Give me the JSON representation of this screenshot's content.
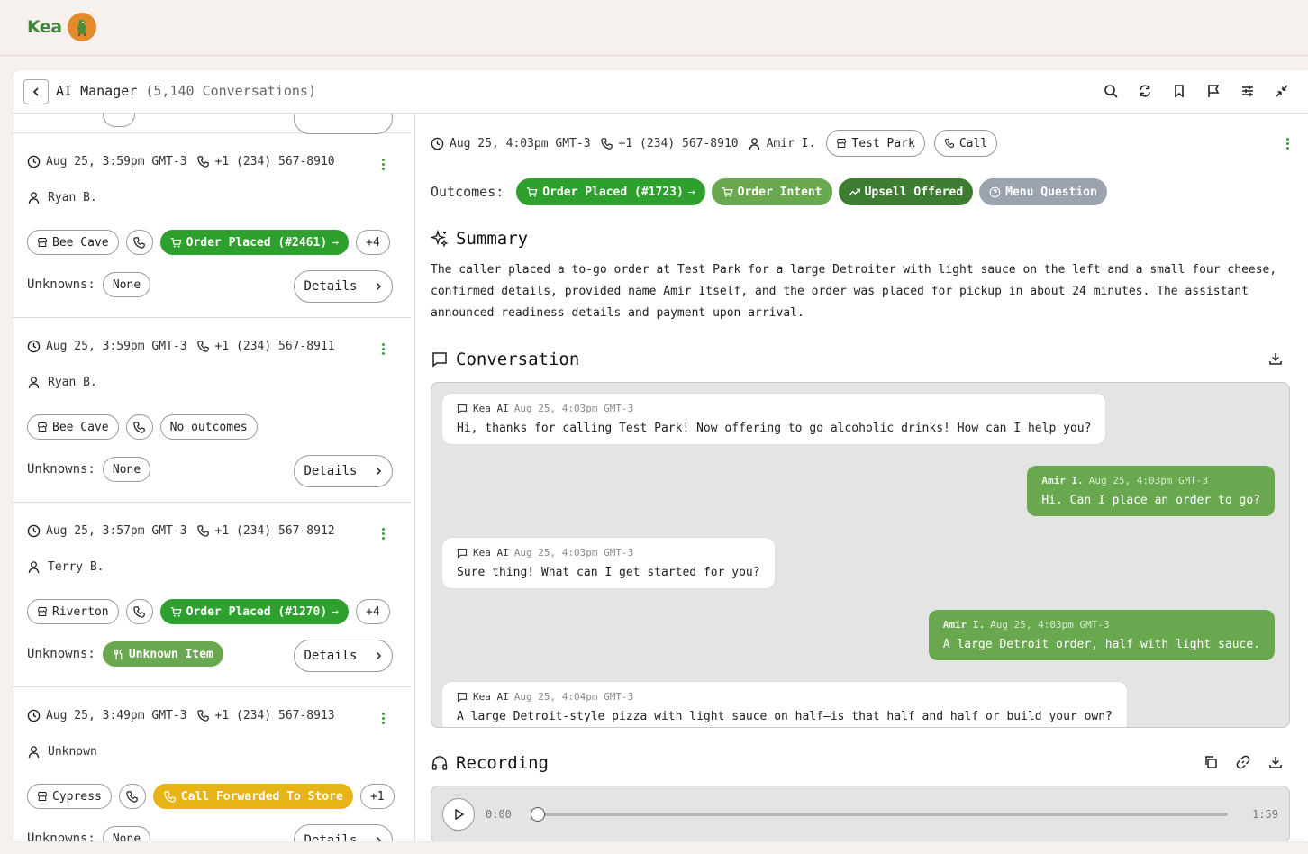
{
  "brand": {
    "name": "Kea"
  },
  "header": {
    "title": "AI Manager",
    "count": "(5,140 Conversations)"
  },
  "conversations": [
    {
      "time": "Aug 25, 3:59pm GMT-3",
      "phone": "+1 (234) 567-8910",
      "name": "Ryan B.",
      "location": "Bee Cave",
      "outcome": "Order Placed (#2461)",
      "outcome_style": "green",
      "extra": "+4",
      "unknowns_label": "Unknowns:",
      "unknown": "None",
      "unknown_style": "plain",
      "details": "Details"
    },
    {
      "time": "Aug 25, 3:59pm GMT-3",
      "phone": "+1 (234) 567-8911",
      "name": "Ryan B.",
      "location": "Bee Cave",
      "outcome": "No outcomes",
      "outcome_style": "plain",
      "extra": "",
      "unknowns_label": "Unknowns:",
      "unknown": "None",
      "unknown_style": "plain",
      "details": "Details"
    },
    {
      "time": "Aug 25, 3:57pm GMT-3",
      "phone": "+1 (234) 567-8912",
      "name": "Terry B.",
      "location": "Riverton",
      "outcome": "Order Placed (#1270)",
      "outcome_style": "green",
      "extra": "+4",
      "unknowns_label": "Unknowns:",
      "unknown": "Unknown Item",
      "unknown_style": "lightgreen",
      "details": "Details"
    },
    {
      "time": "Aug 25, 3:49pm GMT-3",
      "phone": "+1 (234) 567-8913",
      "name": "Unknown",
      "location": "Cypress",
      "outcome": "Call Forwarded To Store",
      "outcome_style": "yellow",
      "extra": "+1",
      "unknowns_label": "Unknowns:",
      "unknown": "None",
      "unknown_style": "plain",
      "details": "Details"
    }
  ],
  "detail": {
    "time": "Aug 25, 4:03pm GMT-3",
    "phone": "+1 (234) 567-8910",
    "name": "Amir I.",
    "location": "Test Park",
    "channel": "Call",
    "outcomes_label": "Outcomes:",
    "outcomes": [
      {
        "label": "Order Placed (#1723)",
        "style": "green"
      },
      {
        "label": "Order Intent",
        "style": "lightgreen"
      },
      {
        "label": "Upsell Offered",
        "style": "darkgreen"
      },
      {
        "label": "Menu Question",
        "style": "grey"
      }
    ],
    "summary_title": "Summary",
    "summary": "The caller placed a to-go order at Test Park for a large Detroiter with light sauce on the left and a small four cheese, confirmed details, provided name Amir Itself, and the order was placed for pickup in about 24 minutes. The assistant announced readiness details and payment upon arrival.",
    "conversation_title": "Conversation",
    "messages": [
      {
        "role": "ai",
        "who": "Kea AI",
        "when": "Aug 25, 4:03pm GMT-3",
        "text": "Hi, thanks for calling Test Park! Now offering to go alcoholic drinks! How can I help you?"
      },
      {
        "role": "user",
        "who": "Amir I.",
        "when": "Aug 25, 4:03pm GMT-3",
        "text": "Hi. Can I place an order to go?"
      },
      {
        "role": "ai",
        "who": "Kea AI",
        "when": "Aug 25, 4:03pm GMT-3",
        "text": "Sure thing! What can I get started for you?"
      },
      {
        "role": "user",
        "who": "Amir I.",
        "when": "Aug 25, 4:03pm GMT-3",
        "text": "A large Detroit order, half with light sauce."
      },
      {
        "role": "ai",
        "who": "Kea AI",
        "when": "Aug 25, 4:04pm GMT-3",
        "text": "A large Detroit-style pizza with light sauce on half—is that half and half or build your own?"
      }
    ],
    "recording_title": "Recording",
    "recording": {
      "current": "0:00",
      "duration": "1:59",
      "progress": 0
    }
  },
  "colors": {
    "green": "#2ea02e",
    "lightgreen": "#6aa850",
    "darkgreen": "#3c7d32",
    "yellow": "#e6b416",
    "grey": "#9aa3ae",
    "brand_orange": "#e48a2c"
  },
  "icons": [
    "search-icon",
    "refresh-icon",
    "bookmark-icon",
    "flag-icon",
    "sliders-icon",
    "collapse-icon",
    "clock-icon",
    "phone-icon",
    "user-icon",
    "store-icon",
    "cart-icon",
    "trend-icon",
    "help-icon",
    "sparkle-icon",
    "chat-icon",
    "download-icon",
    "headphones-icon",
    "copy-icon",
    "link-icon",
    "play-icon",
    "fork-knife-icon",
    "chevron-right-icon",
    "chevron-left-icon",
    "kebab-icon"
  ]
}
